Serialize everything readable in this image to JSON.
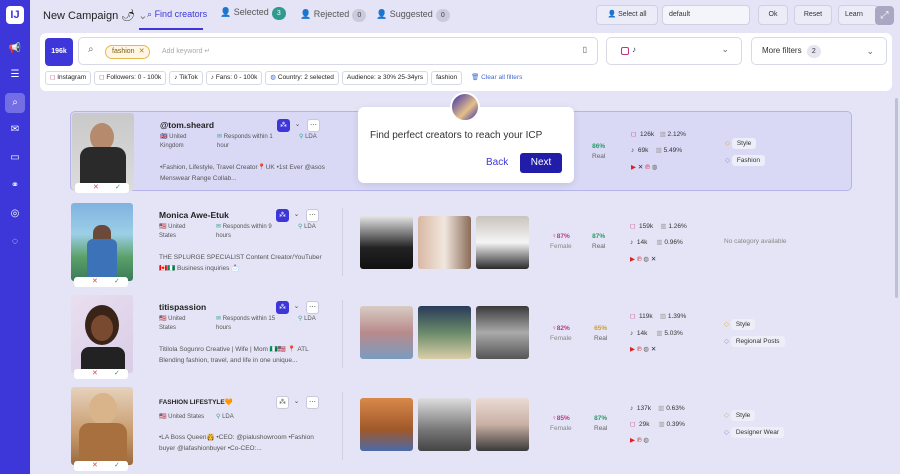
{
  "brand": {
    "logo": "IJ"
  },
  "topbar": {
    "campaign": "New Campaign 🌶",
    "tabs": [
      {
        "label": "Find creators"
      },
      {
        "label": "Selected",
        "count": "3"
      },
      {
        "label": "Rejected",
        "count": "0"
      },
      {
        "label": "Suggested",
        "count": "0"
      }
    ],
    "select_all": "Select all",
    "preset_value": "default",
    "ok": "Ok",
    "reset": "Reset",
    "learn": "Learn"
  },
  "filters": {
    "count": "196k",
    "search_chip": "fashion",
    "keyword_placeholder": "Add keyword ↵",
    "more_filters": "More filters",
    "more_count": "2",
    "chips": [
      "Instagram",
      "Followers: 0 - 100k",
      "TikTok",
      "Fans: 0 - 100k",
      "Country: 2 selected",
      "Audience: ≥ 30% 25-34yrs",
      "fashion"
    ],
    "clear_all": "Clear all filters"
  },
  "popup": {
    "text": "Find perfect creators to reach your ICP",
    "back": "Back",
    "next": "Next"
  },
  "creators": [
    {
      "name": "@tom.sheard",
      "country": "United Kingdom",
      "response": "Responds within 1 hour",
      "lda": "LDA",
      "bio": "•Fashion, Lifestyle, Travel Creator📍UK •1st Ever @asos Menswear Range Collab...",
      "real": "86%",
      "real_label": "Real",
      "ig_followers": "126k",
      "ig_er": "2.12%",
      "tt_followers": "69k",
      "tt_er": "5.49%",
      "cats": [
        "Style",
        "Fashion"
      ]
    },
    {
      "name": "Monica Awe-Etuk",
      "country": "United States",
      "response": "Responds within 9 hours",
      "lda": "LDA",
      "bio": "THE SPLURGE SPECIALIST Content Creator/YouTuber 🇨🇦🇳🇬 Business inquiries 📩",
      "female": "87%",
      "female_label": "Female",
      "real": "87%",
      "real_label": "Real",
      "ig_followers": "159k",
      "ig_er": "1.26%",
      "tt_followers": "14k",
      "tt_er": "0.96%",
      "no_cat": "No category available"
    },
    {
      "name": "titispassion",
      "country": "United States",
      "response": "Responds within 15 hours",
      "lda": "LDA",
      "bio": "Titilola Sogunro Creative | Wife | Mom 🇳🇬🇺🇸 📍 ATL Blending fashion, travel, and life in one unique...",
      "female": "82%",
      "female_label": "Female",
      "real": "65%",
      "real_label": "Real",
      "ig_followers": "119k",
      "ig_er": "1.39%",
      "tt_followers": "14k",
      "tt_er": "5.03%",
      "cats": [
        "Style",
        "Regional Posts"
      ]
    },
    {
      "name": "FASHION LIFESTYLE🧡",
      "country": "United States",
      "lda": "LDA",
      "bio": "•LA Boss Queen👸 •CEO: @pialushowroom •Fashion buyer @lafashionbuyer •Co-CEO:...",
      "female": "85%",
      "female_label": "Female",
      "real": "87%",
      "real_label": "Real",
      "tt_followers": "137k",
      "tt_er": "0.63%",
      "ig_followers": "29k",
      "ig_er": "0.39%",
      "cats": [
        "Style",
        "Designer Wear"
      ]
    }
  ]
}
